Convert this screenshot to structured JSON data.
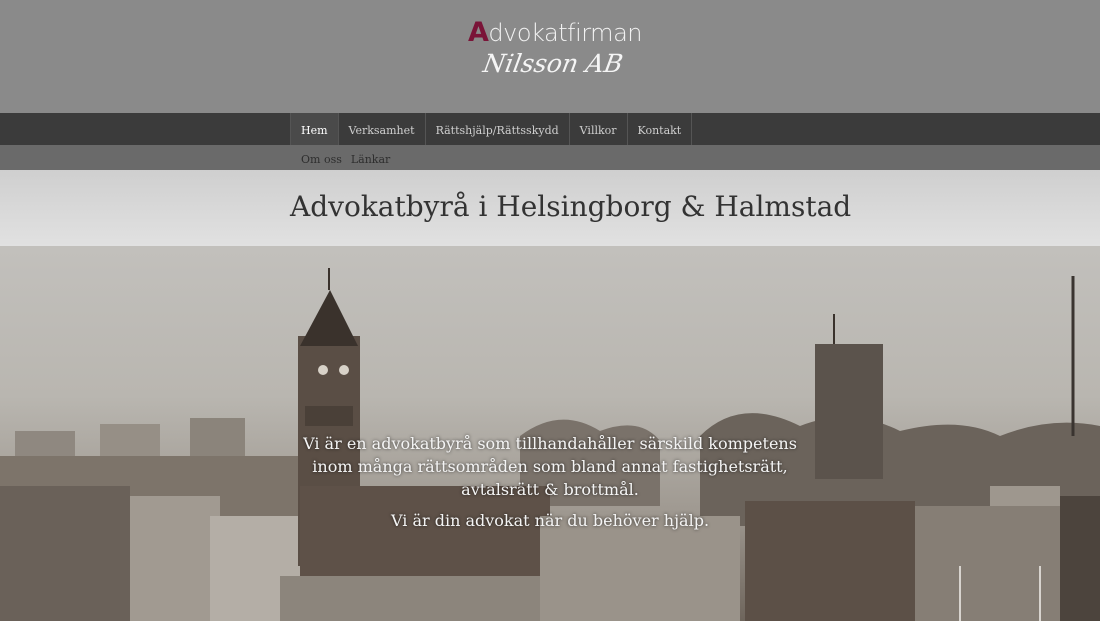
{
  "logo": {
    "initial": "A",
    "line1_rest": "dvokatfirman",
    "line2": "Nilsson AB"
  },
  "nav": {
    "items": [
      {
        "label": "Hem",
        "active": true
      },
      {
        "label": "Verksamhet"
      },
      {
        "label": "Rättshjälp/Rättsskydd"
      },
      {
        "label": "Villkor"
      },
      {
        "label": "Kontakt"
      }
    ],
    "sub_items": [
      {
        "label": "Om oss"
      },
      {
        "label": "Länkar"
      }
    ]
  },
  "page": {
    "title": "Advokatbyrå i Helsingborg & Halmstad"
  },
  "hero": {
    "paragraph1": "Vi är en advokatbyrå som tillhandahåller särskild kompetens inom många rättsområden som bland annat fastighetsrätt, avtalsrätt & brottmål.",
    "paragraph2": "Vi är din advokat när du behöver hjälp."
  },
  "colors": {
    "header_bg": "#8a8a8a",
    "nav_bg": "#3b3b3b",
    "subnav_bg": "#6a6a6a",
    "logo_accent": "#7a1438"
  }
}
